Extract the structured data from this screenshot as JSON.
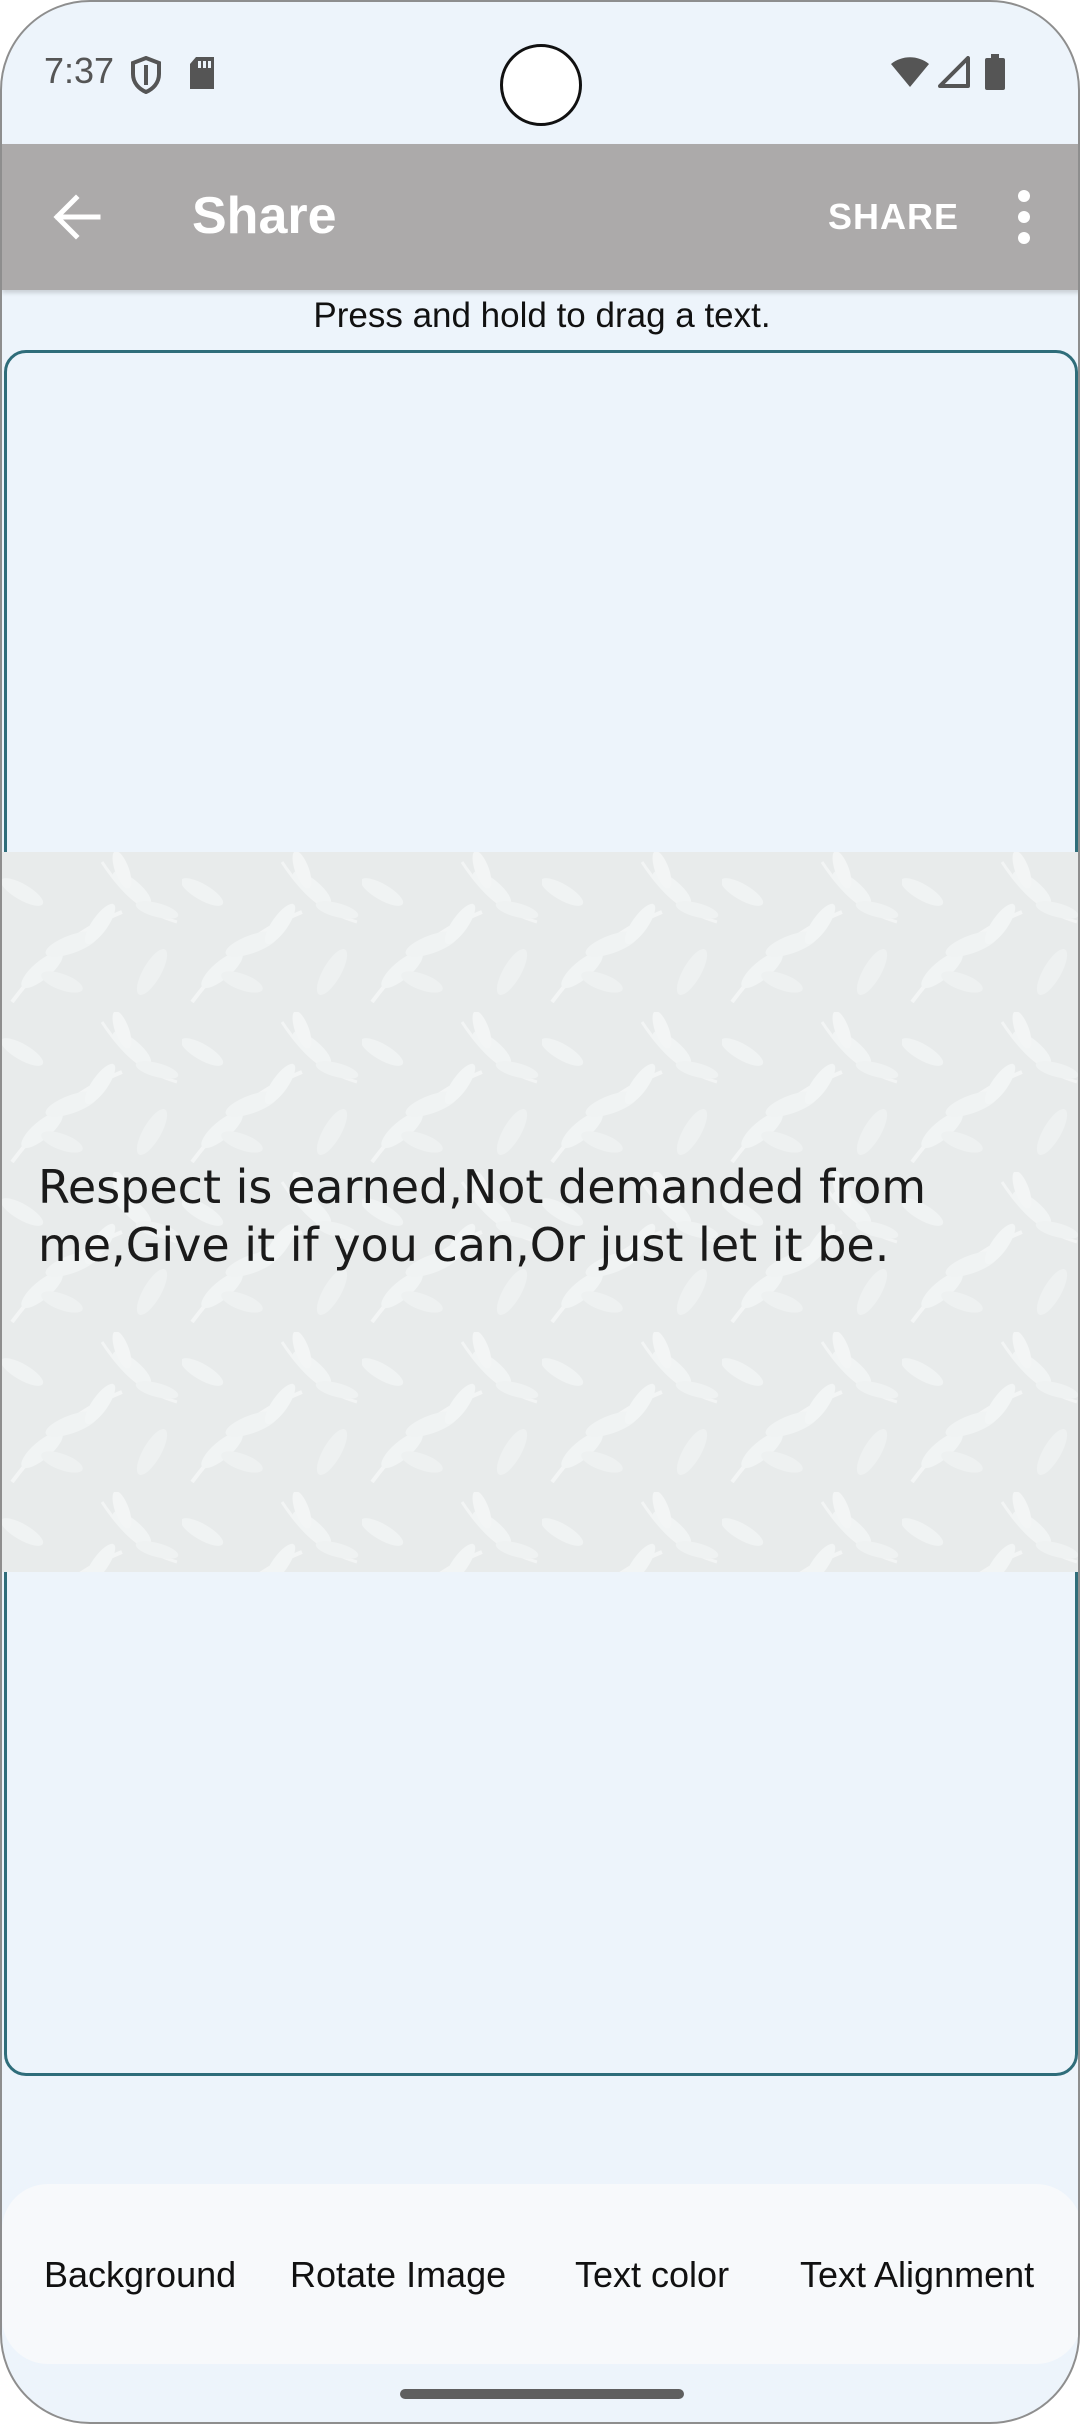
{
  "status_bar": {
    "time": "7:37"
  },
  "app_bar": {
    "title": "Share",
    "share_label": "SHARE",
    "back_icon": "arrow-back-icon",
    "overflow_icon": "more-vert-icon"
  },
  "hint": "Press and hold to drag a text.",
  "quote": {
    "text": "Respect is earned,Not demanded from me,Give it if you can,Or just let it be."
  },
  "tools": [
    {
      "label": "Background"
    },
    {
      "label": "Rotate Image"
    },
    {
      "label": "Text color"
    },
    {
      "label": "Text Alignment"
    }
  ],
  "colors": {
    "app_bar": "#acaaaa",
    "screen_background": "#edf4fb",
    "canvas_border": "#2f6d7a"
  }
}
